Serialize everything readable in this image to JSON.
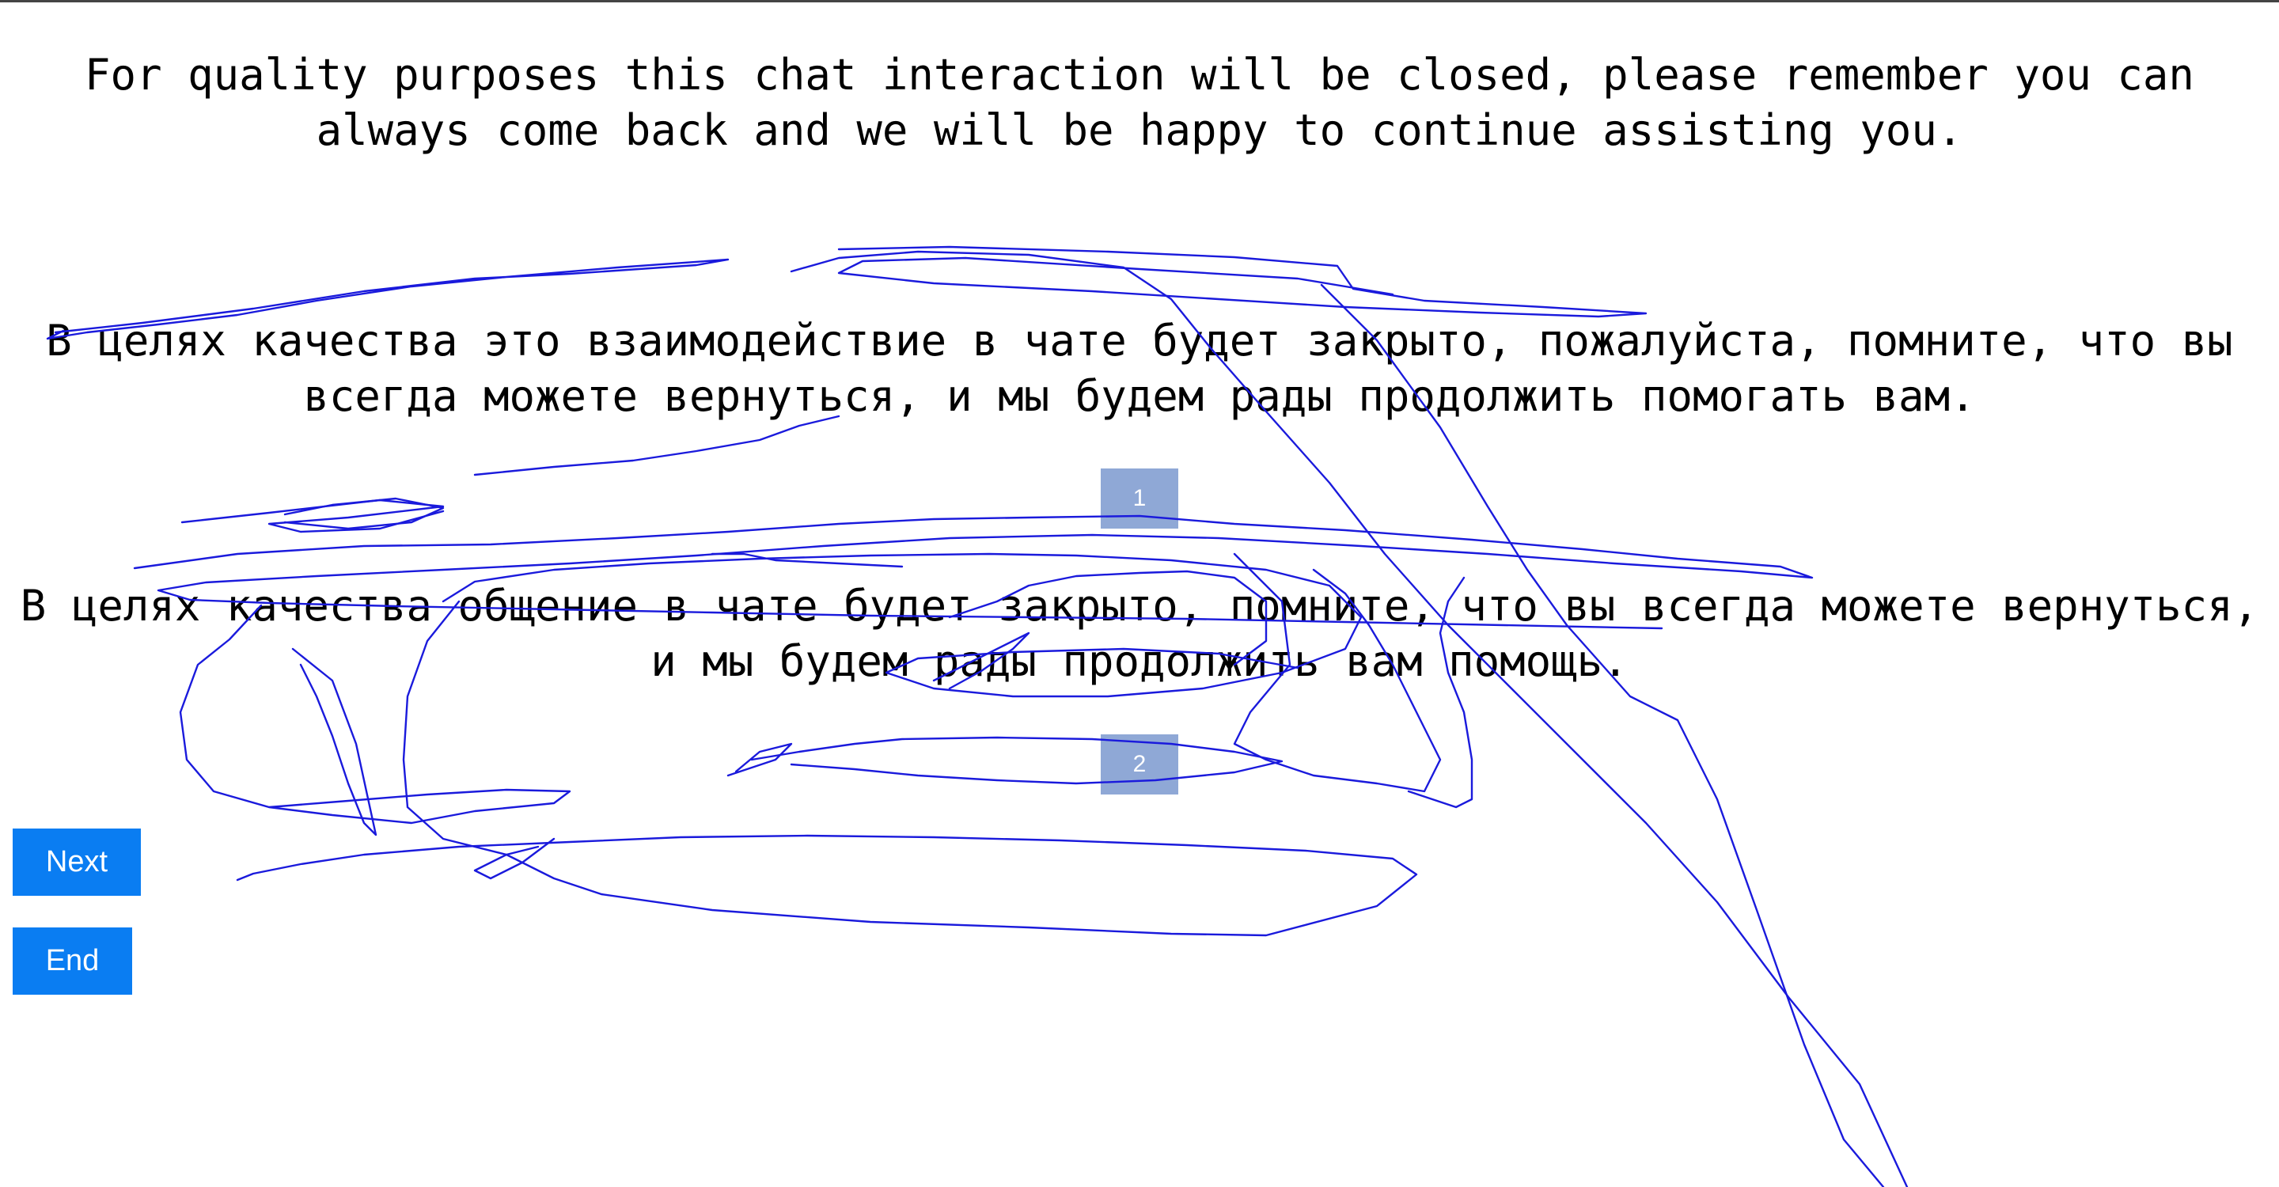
{
  "source_text": "For quality purposes this chat interaction will be closed, please remember you can always come back and we will be happy to continue assisting you.",
  "translations": [
    {
      "text": "В целях качества это взаимодействие в чате будет закрыто, пожалуйста, помните, что вы всегда можете вернуться, и мы будем рады продолжить помогать вам.",
      "rank": "1"
    },
    {
      "text": "В целях качества общение в чате будет закрыто, помните, что вы всегда можете вернуться, и мы будем рады продолжить вам помощь.",
      "rank": "2"
    }
  ],
  "buttons": {
    "next_label": "Next",
    "end_label": "End"
  },
  "colors": {
    "button": "#0a7df2",
    "rank_badge": "#8fa8d6",
    "scribble": "#1a1adc"
  }
}
